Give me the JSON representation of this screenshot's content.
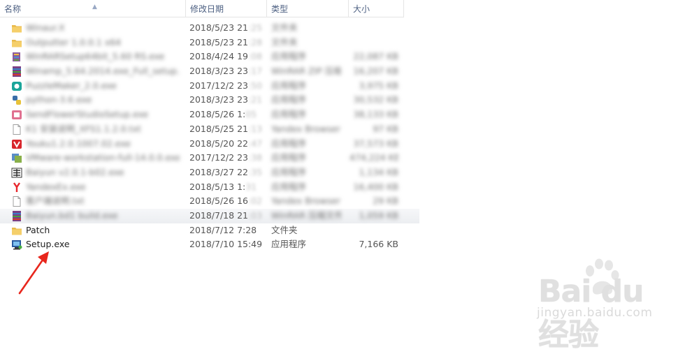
{
  "columns": {
    "name": "名称",
    "date": "修改日期",
    "type": "类型",
    "size": "大小"
  },
  "files": [
    {
      "name": "Winaur.X",
      "date": "2018/5/23 21",
      "date_tail": ":25",
      "type": "文件夹",
      "size": "",
      "icon": "folder-icon",
      "blurred": true
    },
    {
      "name": "Outputter 1.0.0.1 x64",
      "date": "2018/5/23 21",
      "date_tail": ":28",
      "type": "文件夹",
      "size": "",
      "icon": "folder-icon",
      "blurred": true
    },
    {
      "name": "WinRARSetup64bit_5.60 RS.exe",
      "date": "2018/4/24 19",
      "date_tail": ":08",
      "type": "应用程序",
      "size": "22,087 KB",
      "icon": "installer-icon",
      "blurred": true
    },
    {
      "name": "Winamp_5.64.2014.exe_Full_setup.exe",
      "date": "2018/3/23 23",
      "date_tail": ":17",
      "type": "WinRAR ZIP 压缩文件",
      "size": "16,207 KB",
      "icon": "archive-icon",
      "blurred": true
    },
    {
      "name": "PuzzleMaker_2.0.exe",
      "date": "2017/12/2 23",
      "date_tail": ":50",
      "type": "应用程序",
      "size": "3,975 KB",
      "icon": "app-icon",
      "blurred": true
    },
    {
      "name": "python-3.6.exe",
      "date": "2018/3/23 23",
      "date_tail": ":21",
      "type": "应用程序",
      "size": "30,532 KB",
      "icon": "python-icon",
      "blurred": true
    },
    {
      "name": "SendFlowerStudioSetup.exe",
      "date": "2018/5/26 1:",
      "date_tail": "05",
      "type": "应用程序",
      "size": "38,133 KB",
      "icon": "media-icon",
      "blurred": true
    },
    {
      "name": "K1 安装说明_XFS1.1.2.0.txt",
      "date": "2018/5/25 21",
      "date_tail": ":13",
      "type": "Yandex Browser",
      "size": "97 KB",
      "icon": "text-file-icon",
      "blurred": true
    },
    {
      "name": "Youku1.2.0.1007.02.exe",
      "date": "2018/5/20 22",
      "date_tail": ":47",
      "type": "应用程序",
      "size": "37,573 KB",
      "icon": "red-app-icon",
      "blurred": true
    },
    {
      "name": "VMware-workstation-full-14.0.0.exe",
      "date": "2017/12/2 23",
      "date_tail": ":38",
      "type": "应用程序",
      "size": "474,224 KB",
      "icon": "vm-icon",
      "blurred": true
    },
    {
      "name": "Baiyun v2.0.1-b02.exe",
      "date": "2018/3/27 22",
      "date_tail": ":35",
      "type": "应用程序",
      "size": "1,134 KB",
      "icon": "tool-icon",
      "blurred": true
    },
    {
      "name": "YandexEx.exe",
      "date": "2018/5/13 1:",
      "date_tail": "31",
      "type": "应用程序",
      "size": "16,400 KB",
      "icon": "yandex-icon",
      "blurred": true
    },
    {
      "name": "客户端说明.txt",
      "date": "2018/5/26 16",
      "date_tail": ":02",
      "type": "Yandex Browser",
      "size": "29 KB",
      "icon": "text-file-icon",
      "blurred": true
    },
    {
      "name": "Baiyun.bd1 build.exe",
      "date": "2018/7/18 21",
      "date_tail": ":03",
      "type": "WinRAR 压缩文件",
      "size": "1,059 KB",
      "icon": "archive-icon",
      "blurred": true,
      "highlight": true
    },
    {
      "name": "Patch",
      "date": "2018/7/12 7:28",
      "type": "文件夹",
      "size": "",
      "icon": "folder-icon",
      "blurred": false
    },
    {
      "name": "Setup.exe",
      "date": "2018/7/10 15:49",
      "type": "应用程序",
      "size": "7,166 KB",
      "icon": "setup-icon",
      "blurred": false
    }
  ],
  "watermark": {
    "logo_text": "Bai du 经验",
    "url": "jingyan.baidu.com"
  },
  "colors": {
    "header_text": "#4d6082",
    "folder": "#e8b94a",
    "arrow": "#e8261c",
    "watermark": "#e0e0e0"
  }
}
